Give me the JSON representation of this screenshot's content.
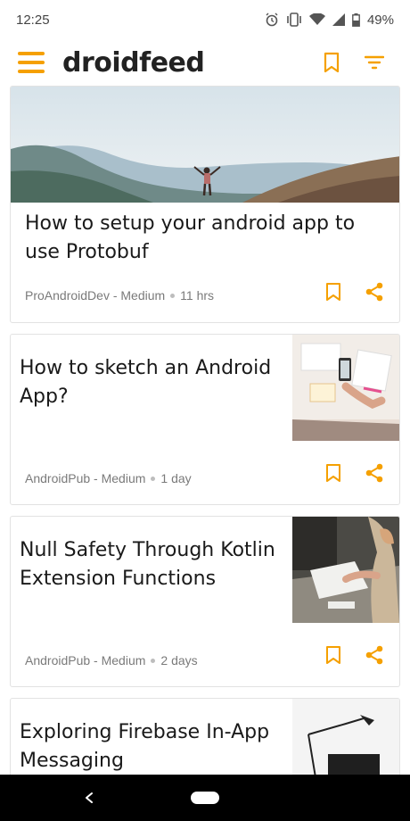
{
  "status_bar": {
    "time": "12:25",
    "battery": "49%",
    "icons": [
      "alarm-icon",
      "vibrate-icon",
      "wifi-icon",
      "signal-icon",
      "battery-icon"
    ]
  },
  "toolbar": {
    "title": "droidfeed",
    "menu_icon": "hamburger-menu-icon",
    "bookmark_icon": "bookmark-icon",
    "filter_icon": "filter-icon"
  },
  "theme": {
    "accent": "#f5a000",
    "text": "#1a1a1a",
    "meta_text": "#7a7a7a",
    "card_border": "#e2e2e2"
  },
  "feed": {
    "articles": [
      {
        "title": "How to setup your android app to use Protobuf",
        "source": "ProAndroidDev - Medium",
        "time": "11 hrs",
        "layout": "hero-image"
      },
      {
        "title": "How to sketch an Android App?",
        "source": "AndroidPub - Medium",
        "time": "1 day",
        "layout": "thumbnail"
      },
      {
        "title": "Null Safety Through Kotlin Extension Functions",
        "source": "AndroidPub - Medium",
        "time": "2 days",
        "layout": "thumbnail"
      },
      {
        "title": "Exploring Firebase In-App Messaging",
        "layout": "thumbnail"
      }
    ]
  },
  "nav_bar": {
    "back_icon": "back-chevron-icon",
    "home_icon": "home-pill-icon"
  }
}
